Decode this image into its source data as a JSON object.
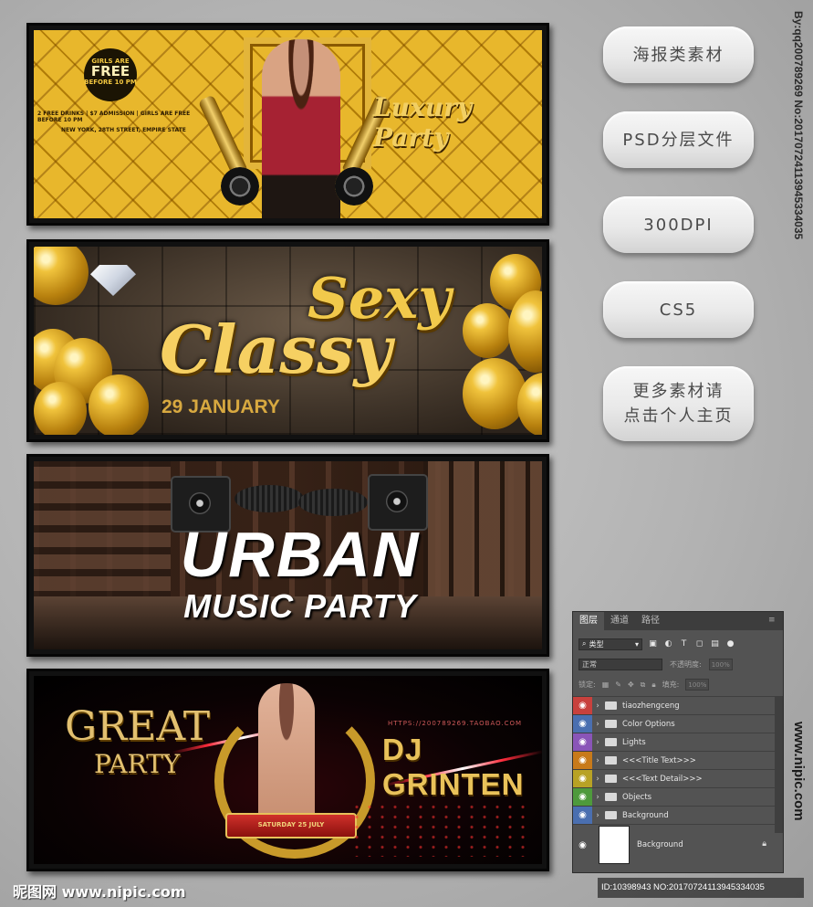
{
  "banner1": {
    "badge_small_top": "GIRLS ARE",
    "badge_big": "FREE",
    "badge_small_bottom": "BEFORE 10 PM",
    "info_line1": "2 FREE DRINKS | $7 ADMISSION | GIRLS ARE FREE BEFORE 10 PM",
    "info_line2": "NEW YORK, 28TH STREET, EMPIRE STATE",
    "title": "Luxury Party"
  },
  "banner2": {
    "title_top": "Sexy",
    "title_main": "Classy",
    "date": "29 JANUARY"
  },
  "banner3": {
    "title": "URBAN",
    "subtitle": "MUSIC PARTY"
  },
  "banner4": {
    "title_big": "GREAT",
    "title_small": "PARTY",
    "url": "HTTPS://200789269.TAOBAO.COM",
    "dj": "DJ GRINTEN",
    "ribbon": "SATURDAY 25 JULY"
  },
  "side_buttons": {
    "b1": "海报类素材",
    "b2": "PSD分层文件",
    "b3": "300DPI",
    "b4": "CS5",
    "b5_line1": "更多素材请",
    "b5_line2": "点击个人主页"
  },
  "watermark_vertical": "By:qq200789269 No:20170724113945334035",
  "watermark_vertical2": "www.nipic.com",
  "layers_panel": {
    "tabs": [
      "图层",
      "通道",
      "路径"
    ],
    "filter_label": "类型",
    "blend_mode": "正常",
    "opacity_label": "不透明度:",
    "opacity_value": "100%",
    "lock_label": "锁定:",
    "fill_label": "填充:",
    "fill_value": "100%",
    "layers": [
      {
        "name": "tiaozhengceng",
        "color": "#c8413d"
      },
      {
        "name": "Color Options",
        "color": "#4a6fb0"
      },
      {
        "name": "Lights",
        "color": "#8a55b8"
      },
      {
        "name": "<<<Title Text>>>",
        "color": "#c87a1a"
      },
      {
        "name": "<<<Text Detail>>>",
        "color": "#b8a225"
      },
      {
        "name": "Objects",
        "color": "#4e9a3c"
      },
      {
        "name": "Background",
        "color": "#4a6fb0"
      }
    ],
    "background_layer": "Background"
  },
  "footer": {
    "logo_text": "昵图网 www.nipic.com",
    "id_text": "ID:10398943 NO:20170724113945334035"
  }
}
